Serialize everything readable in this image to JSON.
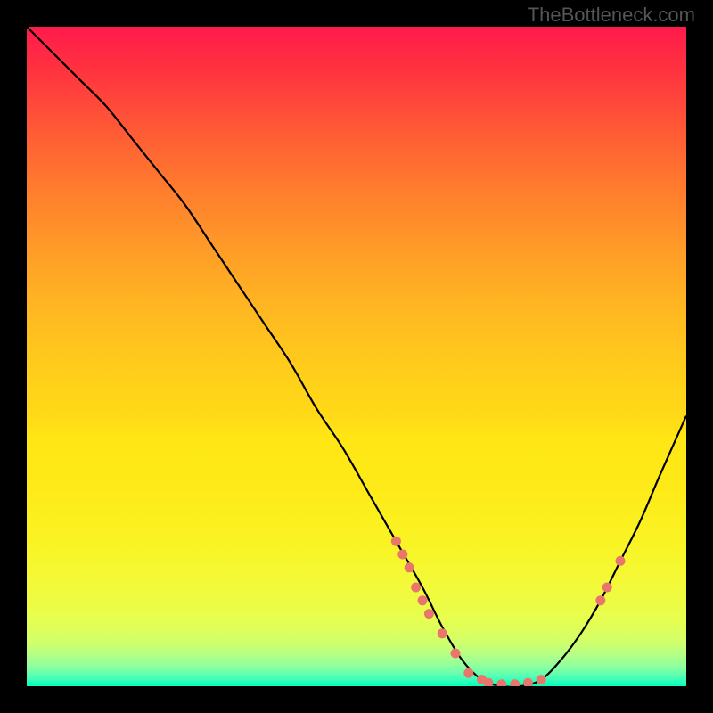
{
  "watermark": "TheBottleneck.com",
  "chart_data": {
    "type": "line",
    "title": "",
    "xlabel": "",
    "ylabel": "",
    "xlim": [
      0,
      100
    ],
    "ylim": [
      0,
      100
    ],
    "series": [
      {
        "name": "curve",
        "x": [
          0,
          4,
          8,
          12,
          16,
          20,
          24,
          28,
          32,
          36,
          40,
          44,
          48,
          52,
          56,
          60,
          63,
          66,
          69,
          72,
          75,
          78,
          81,
          84,
          87,
          90,
          93,
          96,
          100
        ],
        "y": [
          100,
          96,
          92,
          88,
          83,
          78,
          73,
          67,
          61,
          55,
          49,
          42,
          36,
          29,
          22,
          15,
          9,
          4,
          1,
          0,
          0,
          1,
          4,
          8,
          13,
          19,
          25,
          32,
          41
        ]
      }
    ],
    "markers": [
      {
        "x": 56,
        "y": 22
      },
      {
        "x": 57,
        "y": 20
      },
      {
        "x": 58,
        "y": 18
      },
      {
        "x": 59,
        "y": 15
      },
      {
        "x": 60,
        "y": 13
      },
      {
        "x": 61,
        "y": 11
      },
      {
        "x": 63,
        "y": 8
      },
      {
        "x": 65,
        "y": 5
      },
      {
        "x": 67,
        "y": 2
      },
      {
        "x": 69,
        "y": 1
      },
      {
        "x": 70,
        "y": 0.5
      },
      {
        "x": 72,
        "y": 0.3
      },
      {
        "x": 74,
        "y": 0.3
      },
      {
        "x": 76,
        "y": 0.5
      },
      {
        "x": 78,
        "y": 1
      },
      {
        "x": 87,
        "y": 13
      },
      {
        "x": 88,
        "y": 15
      },
      {
        "x": 90,
        "y": 19
      }
    ],
    "gradient_stops": [
      {
        "pos": 0,
        "color": "#ff1a4d"
      },
      {
        "pos": 50,
        "color": "#ffd11a"
      },
      {
        "pos": 90,
        "color": "#e6fe50"
      },
      {
        "pos": 100,
        "color": "#00ffc0"
      }
    ]
  }
}
